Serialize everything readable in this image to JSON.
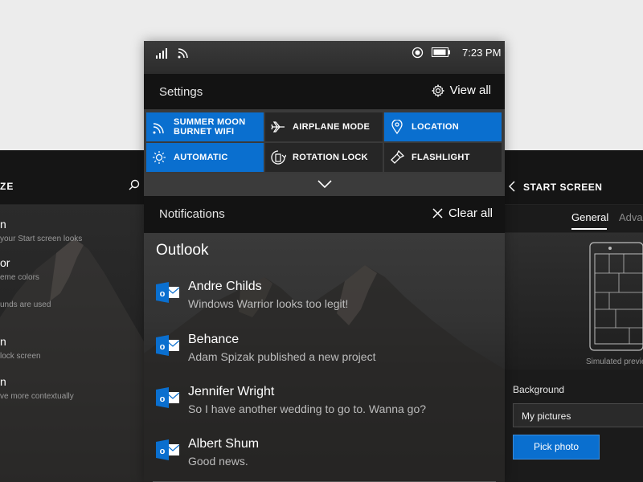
{
  "left_screen": {
    "title": "ZE",
    "items": [
      {
        "title": "n",
        "subtitle": "your Start screen looks"
      },
      {
        "title": "or",
        "subtitle": "eme colors"
      },
      {
        "title": "",
        "subtitle": "unds are used"
      },
      {
        "title": "n",
        "subtitle": "lock screen"
      },
      {
        "title": "n",
        "subtitle": "ve more contextually"
      }
    ]
  },
  "right_screen": {
    "title": "START SCREEN",
    "tabs": [
      {
        "label": "General"
      },
      {
        "label": "Advar"
      }
    ],
    "preview_caption": "Simulated previe",
    "background_label": "Background",
    "background_value": "My pictures",
    "pick_button": "Pick photo"
  },
  "center_screen": {
    "status": {
      "time": "7:23 PM"
    },
    "action_center": {
      "title": "Settings",
      "view_all": "View all",
      "tiles": [
        {
          "line1": "SUMMER MOON",
          "line2": "BURNET WIFI",
          "icon": "wifi-icon",
          "active": true
        },
        {
          "line1": "AIRPLANE MODE",
          "line2": "",
          "icon": "airplane-icon",
          "active": false
        },
        {
          "line1": "LOCATION",
          "line2": "",
          "icon": "location-icon",
          "active": true
        },
        {
          "line1": "AUTOMATIC",
          "line2": "",
          "icon": "brightness-icon",
          "active": true
        },
        {
          "line1": "ROTATION LOCK",
          "line2": "",
          "icon": "rotation-lock-icon",
          "active": false
        },
        {
          "line1": "FLASHLIGHT",
          "line2": "",
          "icon": "flashlight-icon",
          "active": false
        }
      ]
    },
    "notifications": {
      "title": "Notifications",
      "clear_all": "Clear all",
      "app": "Outlook",
      "items": [
        {
          "sender": "Andre Childs",
          "message": "Windows Warrior looks too legit!"
        },
        {
          "sender": "Behance",
          "message": "Adam Spizak published a new project"
        },
        {
          "sender": "Jennifer Wright",
          "message": "So I have another wedding to go to. Wanna go?"
        },
        {
          "sender": "Albert Shum",
          "message": "Good news."
        }
      ]
    }
  },
  "colors": {
    "accent": "#0a6fcf",
    "tile_off": "#262626",
    "background": "#ececec"
  }
}
